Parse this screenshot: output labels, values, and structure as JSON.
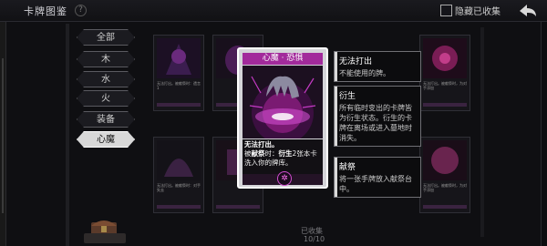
{
  "header": {
    "title": "卡牌图鉴",
    "hide_collected": "隐藏已收集"
  },
  "filters": [
    "全部",
    "木",
    "水",
    "火",
    "装备",
    "心魔"
  ],
  "active_filter": "心魔",
  "detail": {
    "name": "心魔 · 恐惧",
    "line1": "无法打出。",
    "line2_pre": "被",
    "line2_kw": "献祭",
    "line2_mid": "时：",
    "line2_kw2": "衍生",
    "line2_post": "2张本卡洗入你的牌库。"
  },
  "tooltips": [
    {
      "title": "无法打出",
      "body": "不能使用的牌。"
    },
    {
      "title": "衍生",
      "body": "所有临时变出的卡牌皆为衍生状态。衍生的卡牌在离场或进入墓地时消失。"
    },
    {
      "title": "献祭",
      "body": "将一张手牌放入献祭台中。"
    }
  ],
  "footer": {
    "collected_label": "已收集",
    "collected_count": "10/10"
  },
  "colors": {
    "accent": "#a22a9b",
    "glow": "#d14dd0"
  }
}
